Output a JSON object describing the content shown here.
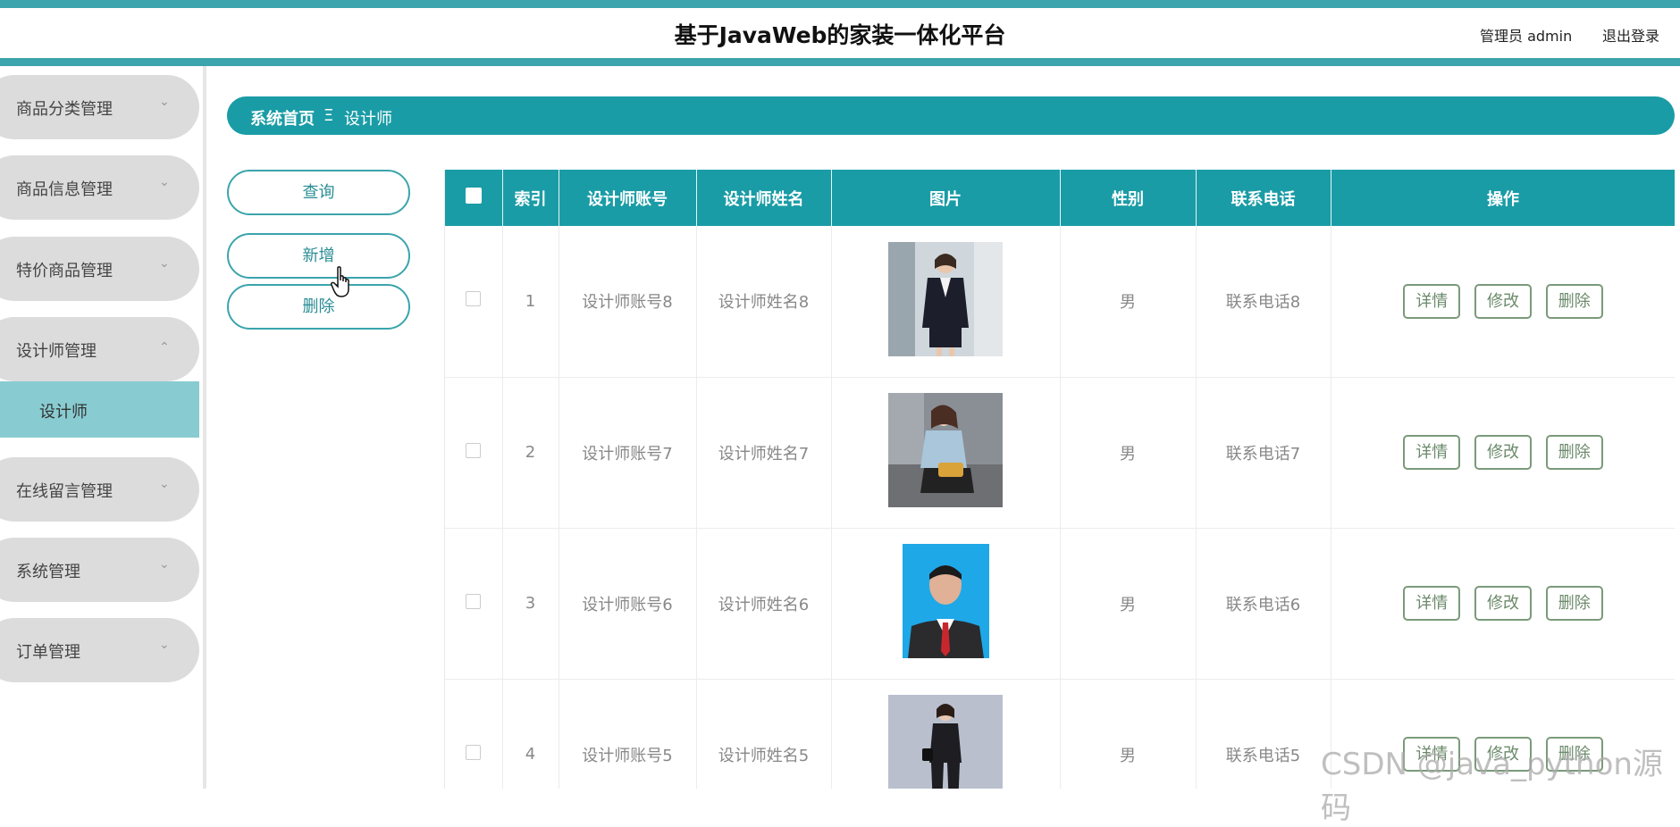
{
  "header": {
    "title": "基于JavaWeb的家装一体化平台",
    "admin_label": "管理员 admin",
    "logout_label": "退出登录"
  },
  "sidebar": {
    "items": [
      {
        "label": "商品分类管理",
        "arrow": "⌄"
      },
      {
        "label": "商品信息管理",
        "arrow": "⌄"
      },
      {
        "label": "特价商品管理",
        "arrow": "⌄"
      },
      {
        "label": "设计师管理",
        "arrow": "⌃"
      },
      {
        "label": "在线留言管理",
        "arrow": "⌄"
      },
      {
        "label": "系统管理",
        "arrow": "⌄"
      },
      {
        "label": "订单管理",
        "arrow": "⌄"
      }
    ],
    "submenu_active": "设计师"
  },
  "breadcrumb": {
    "home": "系统首页",
    "separator": "Ξ",
    "current": "设计师"
  },
  "actions": {
    "query": "查询",
    "add": "新增",
    "delete": "删除"
  },
  "table": {
    "headers": [
      "索引",
      "设计师账号",
      "设计师姓名",
      "图片",
      "性别",
      "联系电话",
      "操作"
    ],
    "rows": [
      {
        "index": "1",
        "account": "设计师账号8",
        "name": "设计师姓名8",
        "gender": "男",
        "phone": "联系电话8"
      },
      {
        "index": "2",
        "account": "设计师账号7",
        "name": "设计师姓名7",
        "gender": "男",
        "phone": "联系电话7"
      },
      {
        "index": "3",
        "account": "设计师账号6",
        "name": "设计师姓名6",
        "gender": "男",
        "phone": "联系电话6"
      },
      {
        "index": "4",
        "account": "设计师账号5",
        "name": "设计师姓名5",
        "gender": "男",
        "phone": "联系电话5"
      }
    ],
    "op_labels": {
      "detail": "详情",
      "edit": "修改",
      "delete": "删除"
    }
  },
  "watermark": "CSDN @java_python源码",
  "colors": {
    "accent": "#1a9ca6",
    "strip": "#3ba4ac",
    "submenu": "#88ccd2",
    "menu_bg": "#dcdcdc"
  }
}
